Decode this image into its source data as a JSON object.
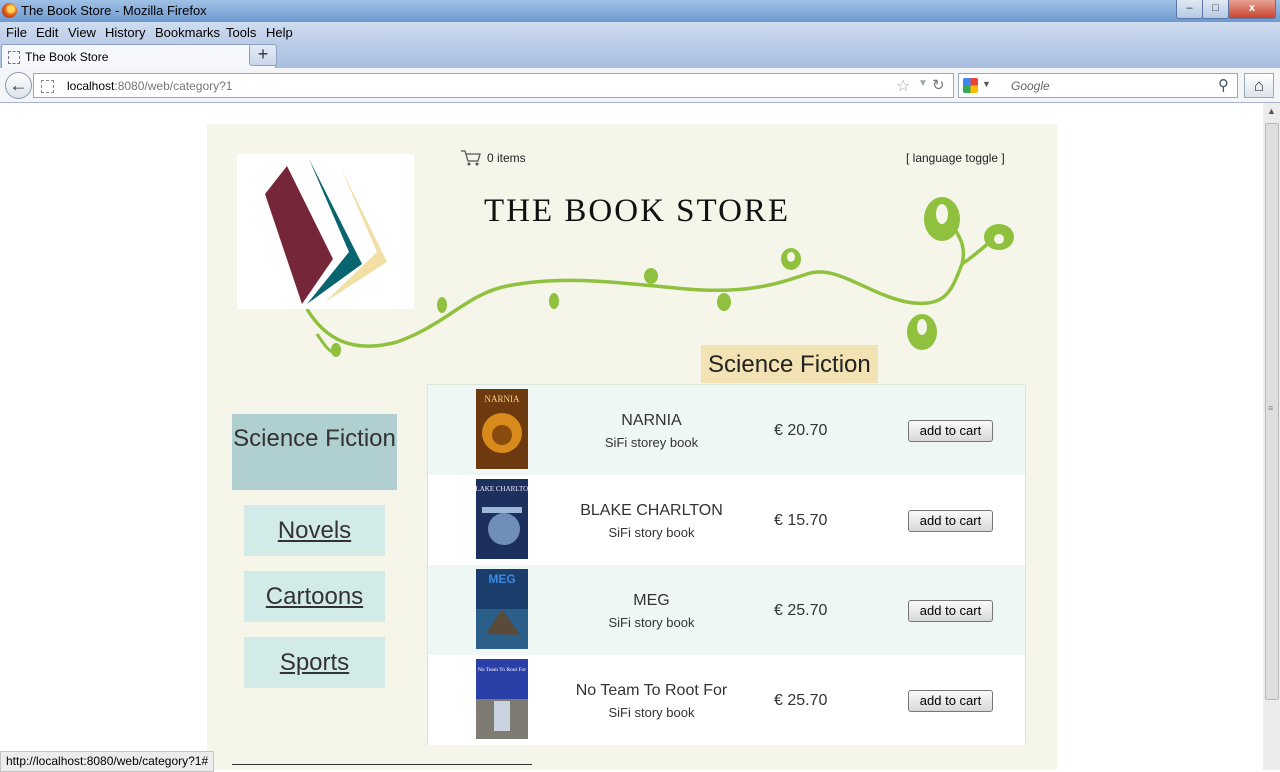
{
  "window": {
    "title": "The Book Store - Mozilla Firefox",
    "controls": {
      "minimize": "–",
      "maximize": "□",
      "close": "x"
    }
  },
  "menubar": {
    "items": [
      "File",
      "Edit",
      "View",
      "History",
      "Bookmarks",
      "Tools",
      "Help"
    ]
  },
  "tabs": [
    {
      "label": "The Book Store"
    }
  ],
  "newtab_label": "+",
  "nav": {
    "url_host": "localhost",
    "url_rest": ":8080/web/category?1",
    "search_placeholder": "Google"
  },
  "status_url": "http://localhost:8080/web/category?1#",
  "page": {
    "store_title": "THE BOOK STORE",
    "cart_text": "0 items",
    "language_toggle": "[ language toggle ]",
    "category_title": "Science Fiction",
    "categories": {
      "selected": "Science Fiction",
      "others": [
        "Novels",
        "Cartoons",
        "Sports"
      ]
    },
    "products": [
      {
        "name": "NARNIA",
        "description": "SiFi storey book",
        "price": "€ 20.70",
        "button": "add to cart",
        "cover_text": "NARNIA"
      },
      {
        "name": "BLAKE CHARLTON",
        "description": "SiFi story book",
        "price": "€ 15.70",
        "button": "add to cart",
        "cover_text": "BLAKE CHARLTON"
      },
      {
        "name": "MEG",
        "description": "SiFi story book",
        "price": "€ 25.70",
        "button": "add to cart",
        "cover_text": "MEG"
      },
      {
        "name": "No Team To Root For",
        "description": "SiFi story book",
        "price": "€ 25.70",
        "button": "add to cart",
        "cover_text": "No Team To Root For"
      }
    ]
  },
  "colors": {
    "page_background": "#f5f5e9",
    "category_title_bg": "#f3e2b4",
    "selected_category_bg": "#afcfd0",
    "category_bg": "#d2ebe8",
    "vine_green": "#8fc13e",
    "logo_maroon": "#752639",
    "logo_teal": "#08646f",
    "logo_cream": "#f2dfa4"
  }
}
